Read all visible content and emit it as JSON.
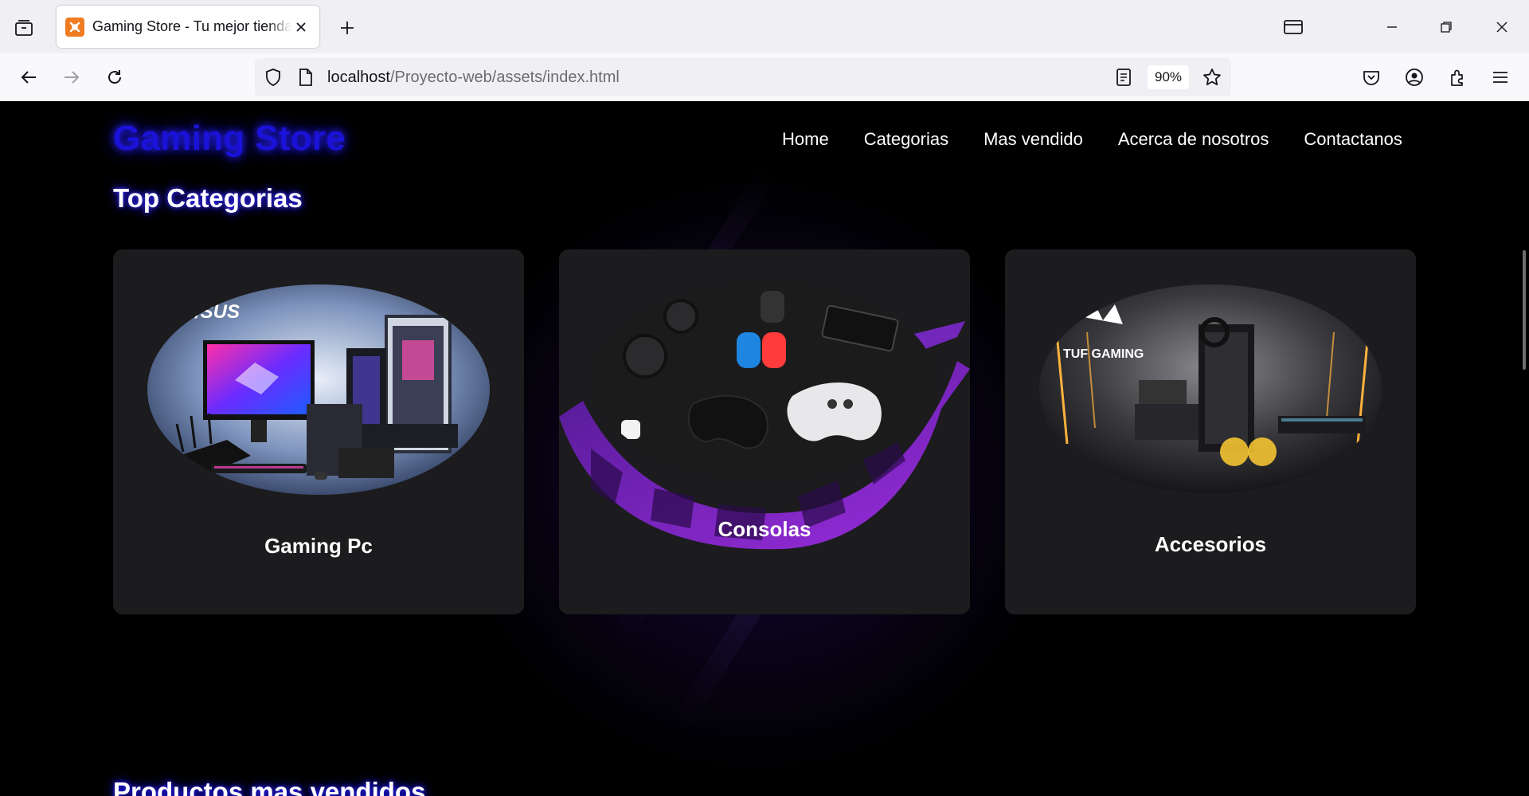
{
  "browser": {
    "tab": {
      "title": "Gaming Store - Tu mejor tienda",
      "favicon": "xampp-icon"
    },
    "url": {
      "host": "localhost",
      "path": "/Proyecto-web/assets/index.html"
    },
    "zoom": "90%"
  },
  "site": {
    "logo": "Gaming Store",
    "menu": [
      "Home",
      "Categorias",
      "Mas vendido",
      "Acerca de nosotros",
      "Contactanos"
    ],
    "top_categories_title": "Top Categorias",
    "categories": [
      {
        "label": "Gaming Pc",
        "image": "gaming-pc-image"
      },
      {
        "label": "Consolas",
        "image": "consoles-image"
      },
      {
        "label": "Accesorios",
        "image": "accessories-image"
      }
    ],
    "best_sellers_title": "Productos mas vendidos"
  },
  "colors": {
    "logo": "#1a12d8",
    "card": "#1c1c1e",
    "accent_purple": "#8a2be2"
  }
}
